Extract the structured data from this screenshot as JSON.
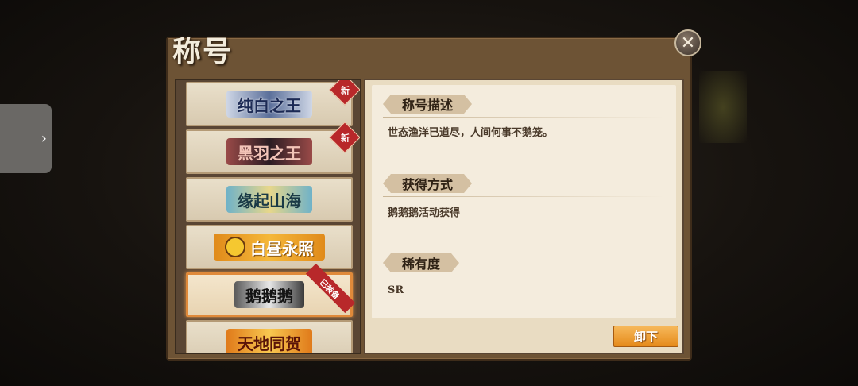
{
  "side_tab": {
    "icon": "chevron-right-icon",
    "glyph": "›"
  },
  "panel": {
    "title": "称号"
  },
  "close_button": {
    "icon": "close-icon",
    "glyph": "✕"
  },
  "titles": [
    {
      "name": "纯白之王",
      "badge": "新"
    },
    {
      "name": "黑羽之王",
      "badge": "新"
    },
    {
      "name": "缘起山海",
      "badge": ""
    },
    {
      "name": "白昼永照",
      "badge": ""
    },
    {
      "name": "鹅鹅鹅",
      "badge": "已装备"
    },
    {
      "name": "天地同贺",
      "badge": ""
    }
  ],
  "details": {
    "description_label": "称号描述",
    "description_text": "世态渔洋已道尽，人间何事不鹅笼。",
    "obtain_label": "获得方式",
    "obtain_text": "鹅鹅鹅活动获得",
    "rarity_label": "稀有度",
    "rarity_text": "SR"
  },
  "unequip_button": {
    "label": "卸下"
  },
  "colors": {
    "accent_orange": "#e58a1a",
    "panel_brown": "#6d5335",
    "new_badge_red": "#b8282a"
  }
}
